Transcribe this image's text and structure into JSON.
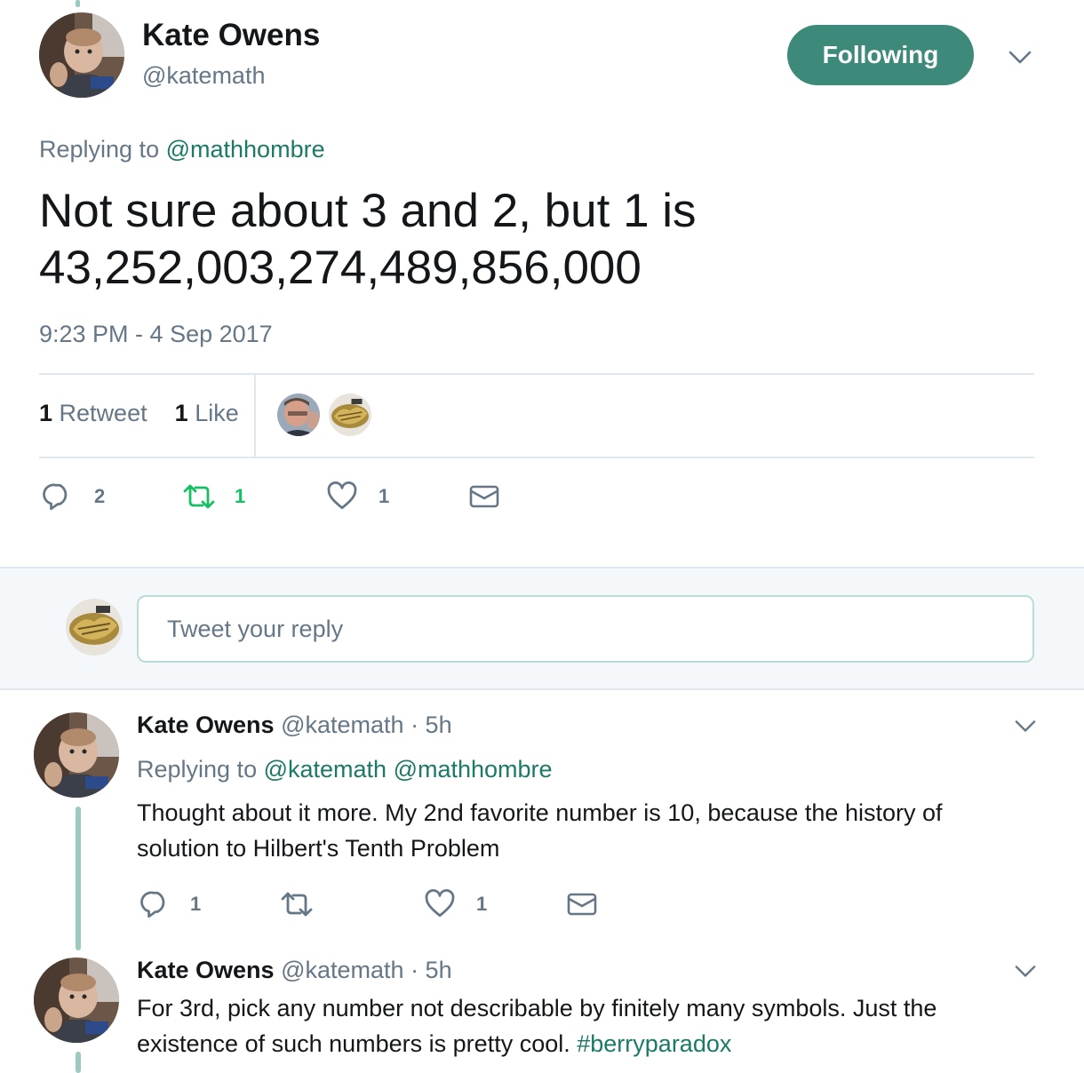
{
  "tweet": {
    "author_name": "Kate Owens",
    "author_handle": "@katemath",
    "follow_label": "Following",
    "replying_prefix": "Replying to",
    "replying_to": "@mathhombre",
    "text_line1": "Not sure about 3 and 2, but 1 is",
    "text_line2": "43,252,003,274,489,856,000",
    "timestamp": "9:23 PM - 4 Sep 2017",
    "retweet_count": "1",
    "retweet_label": "Retweet",
    "like_count": "1",
    "like_label": "Like",
    "actions": {
      "reply_count": "2",
      "retweet_count": "1",
      "like_count": "1"
    }
  },
  "composer": {
    "placeholder": "Tweet your reply"
  },
  "replies": [
    {
      "author_name": "Kate Owens",
      "author_handle": "@katemath",
      "time": "· 5h",
      "replying_prefix": "Replying to",
      "replying_to": "@katemath @mathhombre",
      "text": "Thought about it more. My 2nd favorite number is 10, because the history of solution to Hilbert's Tenth Problem",
      "reply_count": "1",
      "retweet_count": "",
      "like_count": "1"
    },
    {
      "author_name": "Kate Owens",
      "author_handle": "@katemath",
      "time": "· 5h",
      "text": "For 3rd, pick any number not describable by finitely many symbols. Just the existence of such numbers is pretty cool.",
      "hashtag": "#berryparadox"
    }
  ],
  "colors": {
    "accent": "#1b7a66",
    "follow_button": "#3d8a7a",
    "retweet_active": "#17bf63",
    "thread_line": "#9cc9c0",
    "muted_text": "#657786"
  },
  "icons": {
    "reply": "reply-icon",
    "retweet": "retweet-icon",
    "like": "heart-icon",
    "dm": "envelope-icon",
    "caret": "chevron-down-icon"
  }
}
